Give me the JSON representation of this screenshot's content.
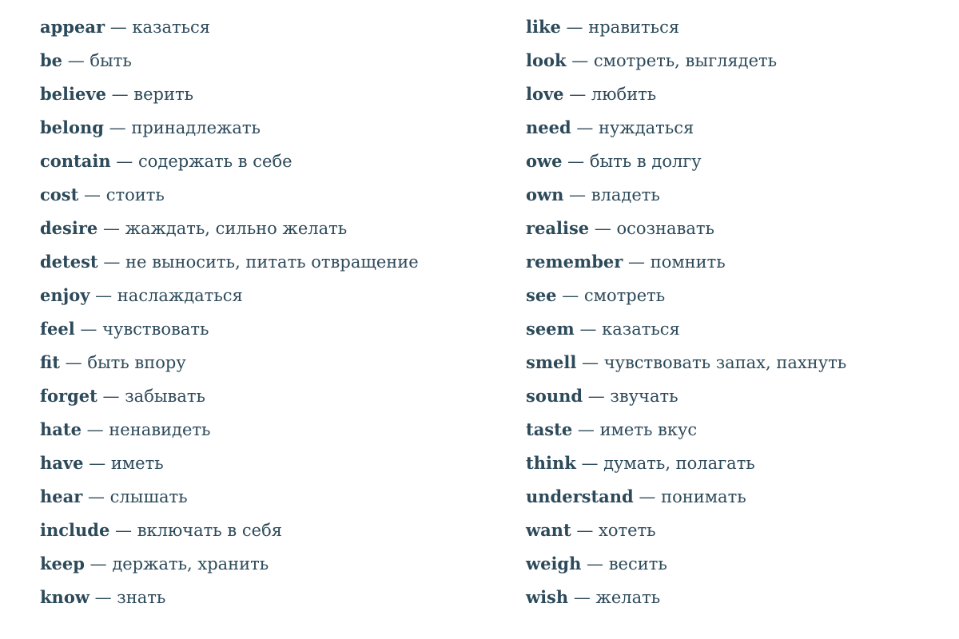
{
  "separator": " — ",
  "text_color": "#2d4a5a",
  "left_column": [
    {
      "en": "appear",
      "ru": "казаться"
    },
    {
      "en": "be",
      "ru": "быть"
    },
    {
      "en": "believe",
      "ru": "верить"
    },
    {
      "en": "belong",
      "ru": "принадлежать"
    },
    {
      "en": "contain",
      "ru": "содержать в себе"
    },
    {
      "en": "cost",
      "ru": "стоить"
    },
    {
      "en": "desire",
      "ru": "жаждать, сильно желать"
    },
    {
      "en": "detest",
      "ru": "не выносить, питать отвращение"
    },
    {
      "en": "enjoy",
      "ru": "наслаждаться"
    },
    {
      "en": "feel",
      "ru": "чувствовать"
    },
    {
      "en": "fit",
      "ru": "быть впору"
    },
    {
      "en": "forget",
      "ru": "забывать"
    },
    {
      "en": "hate",
      "ru": "ненавидеть"
    },
    {
      "en": "have",
      "ru": "иметь"
    },
    {
      "en": "hear",
      "ru": "слышать"
    },
    {
      "en": "include",
      "ru": "включать в себя"
    },
    {
      "en": "keep",
      "ru": "держать, хранить"
    },
    {
      "en": "know",
      "ru": "знать"
    }
  ],
  "right_column": [
    {
      "en": "like",
      "ru": "нравиться"
    },
    {
      "en": "look",
      "ru": "смотреть, выглядеть"
    },
    {
      "en": "love",
      "ru": "любить"
    },
    {
      "en": "need",
      "ru": "нуждаться"
    },
    {
      "en": "owe",
      "ru": "быть в долгу"
    },
    {
      "en": "own",
      "ru": "владеть"
    },
    {
      "en": "realise",
      "ru": "осознавать"
    },
    {
      "en": "remember",
      "ru": "помнить"
    },
    {
      "en": "see",
      "ru": "смотреть"
    },
    {
      "en": "seem",
      "ru": "казаться"
    },
    {
      "en": "smell",
      "ru": "чувствовать запах, пахнуть"
    },
    {
      "en": "sound",
      "ru": "звучать"
    },
    {
      "en": "taste",
      "ru": "иметь вкус"
    },
    {
      "en": "think",
      "ru": "думать, полагать"
    },
    {
      "en": "understand",
      "ru": "понимать"
    },
    {
      "en": "want",
      "ru": "хотеть"
    },
    {
      "en": "weigh",
      "ru": "весить"
    },
    {
      "en": "wish",
      "ru": "желать"
    }
  ]
}
